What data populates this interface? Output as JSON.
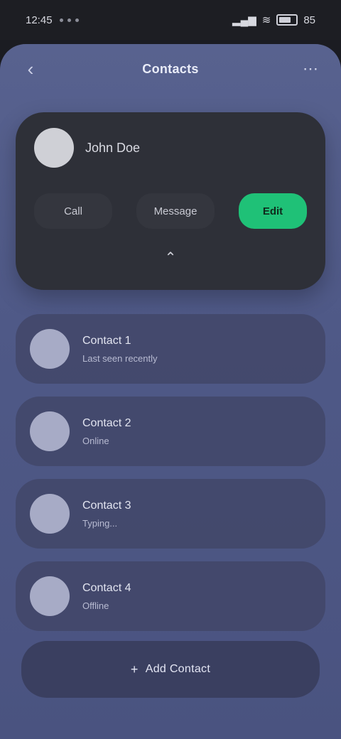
{
  "status": {
    "time": "12:45",
    "battery": "85"
  },
  "topbar": {
    "title": "Contacts"
  },
  "profile": {
    "initial": "",
    "name": "John Doe",
    "actions": [
      {
        "label": "Call"
      },
      {
        "label": "Message"
      },
      {
        "label": "Edit"
      }
    ]
  },
  "contacts": [
    {
      "title": "Contact 1",
      "sub": "Last seen recently"
    },
    {
      "title": "Contact 2",
      "sub": "Online"
    },
    {
      "title": "Contact 3",
      "sub": "Typing..."
    },
    {
      "title": "Contact 4",
      "sub": "Offline"
    }
  ],
  "bottom": {
    "label": "Add Contact"
  }
}
